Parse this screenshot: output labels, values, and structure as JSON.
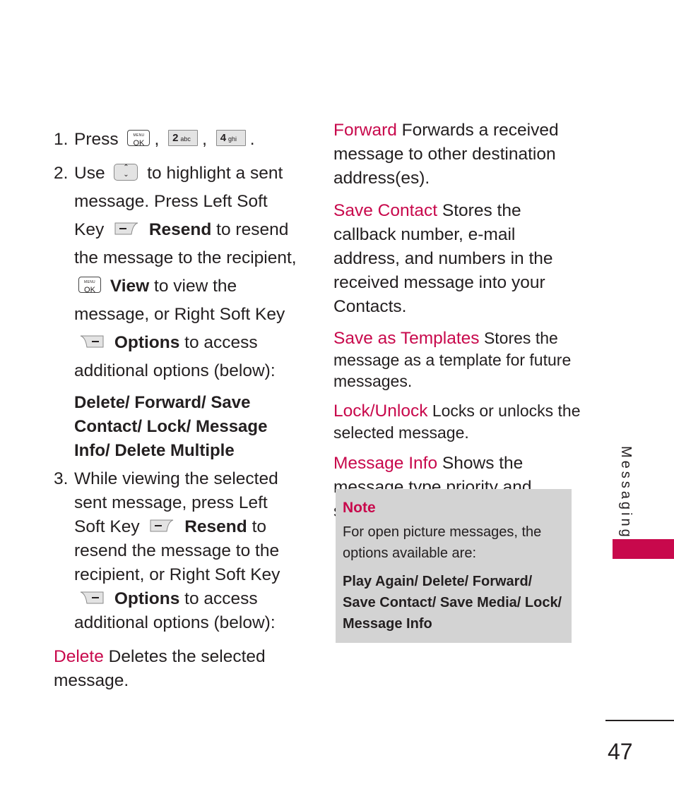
{
  "accent_color": "#c8094c",
  "note_background": "#d3d3d3",
  "steps": [
    {
      "num": "1.",
      "prefix": "Press",
      "keys": [
        {
          "icon": "menu-ok-key-icon",
          "top": "MENU",
          "main": "OK"
        },
        {
          "icon": "key-2-abc-icon",
          "main": "2",
          "sub": "abc"
        },
        {
          "icon": "key-4-ghi-icon",
          "main": "4",
          "sub": "ghi"
        }
      ]
    },
    {
      "num": "2.",
      "t1": "Use",
      "t2": "to highlight a sent message. Press Left Soft Key",
      "resend": "Resend",
      "t3": "to resend the message to the recipient,",
      "ok_top": "MENU",
      "ok_main": "OK",
      "view": "View",
      "t4": "to view the message, or Right Soft Key",
      "options": "Options",
      "t5": "to access additional options (below):",
      "options_list": "Delete/ Forward/ Save Contact/ Lock/ Message Info/ Delete Multiple"
    },
    {
      "num": "3.",
      "t1": "While viewing the selected sent message, press Left Soft Key",
      "resend": "Resend",
      "t2": "to resend the message to the recipient, or Right Soft Key",
      "options": "Options",
      "t3": "to access additional options (below):"
    }
  ],
  "entries": [
    {
      "term": "Delete",
      "desc": "Deletes the selected message."
    },
    {
      "term": "Forward",
      "desc": "Forwards a received message to other destination address(es)."
    },
    {
      "term": "Save Contact",
      "desc": "Stores the callback number, e-mail address, and numbers in the received message into your Contacts."
    },
    {
      "term": "Save as Templates",
      "desc": "Stores the message as a template for future messages."
    },
    {
      "term": "Lock/Unlock",
      "desc": "Locks or unlocks the selected message."
    },
    {
      "term": "Message Info",
      "desc": "Shows the message type priority and status."
    }
  ],
  "note": {
    "title": "Note",
    "body": "For open picture messages, the options available are:",
    "options": "Play Again/ Delete/ Forward/ Save Contact/ Save Media/ Lock/ Message Info"
  },
  "section_label": "Messaging",
  "page_number": "47"
}
